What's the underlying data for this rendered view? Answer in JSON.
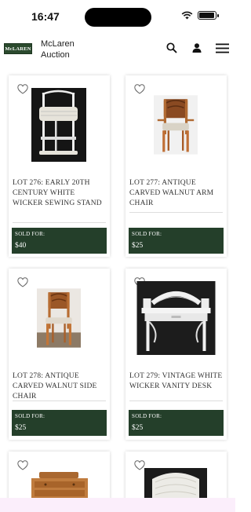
{
  "status": {
    "time": "16:47"
  },
  "header": {
    "logo_text": "McLAREN",
    "brand_line1": "McLaren",
    "brand_line2": "Auction"
  },
  "lots": [
    {
      "title": "LOT 276: EARLY 20TH CENTURY WHITE WICKER SEWING STAND",
      "sold_label": "SOLD FOR:",
      "price": "$40"
    },
    {
      "title": "LOT 277: ANTIQUE CARVED WALNUT ARM CHAIR",
      "sold_label": "SOLD FOR:",
      "price": "$25"
    },
    {
      "title": "LOT 278: ANTIQUE CARVED WALNUT SIDE CHAIR",
      "sold_label": "SOLD FOR:",
      "price": "$25"
    },
    {
      "title": "LOT 279: VINTAGE WHITE WICKER VANITY DESK",
      "sold_label": "SOLD FOR:",
      "price": "$25"
    }
  ],
  "colors": {
    "sold_bg": "#243f2a",
    "logo_bg": "#2b4a2e"
  }
}
